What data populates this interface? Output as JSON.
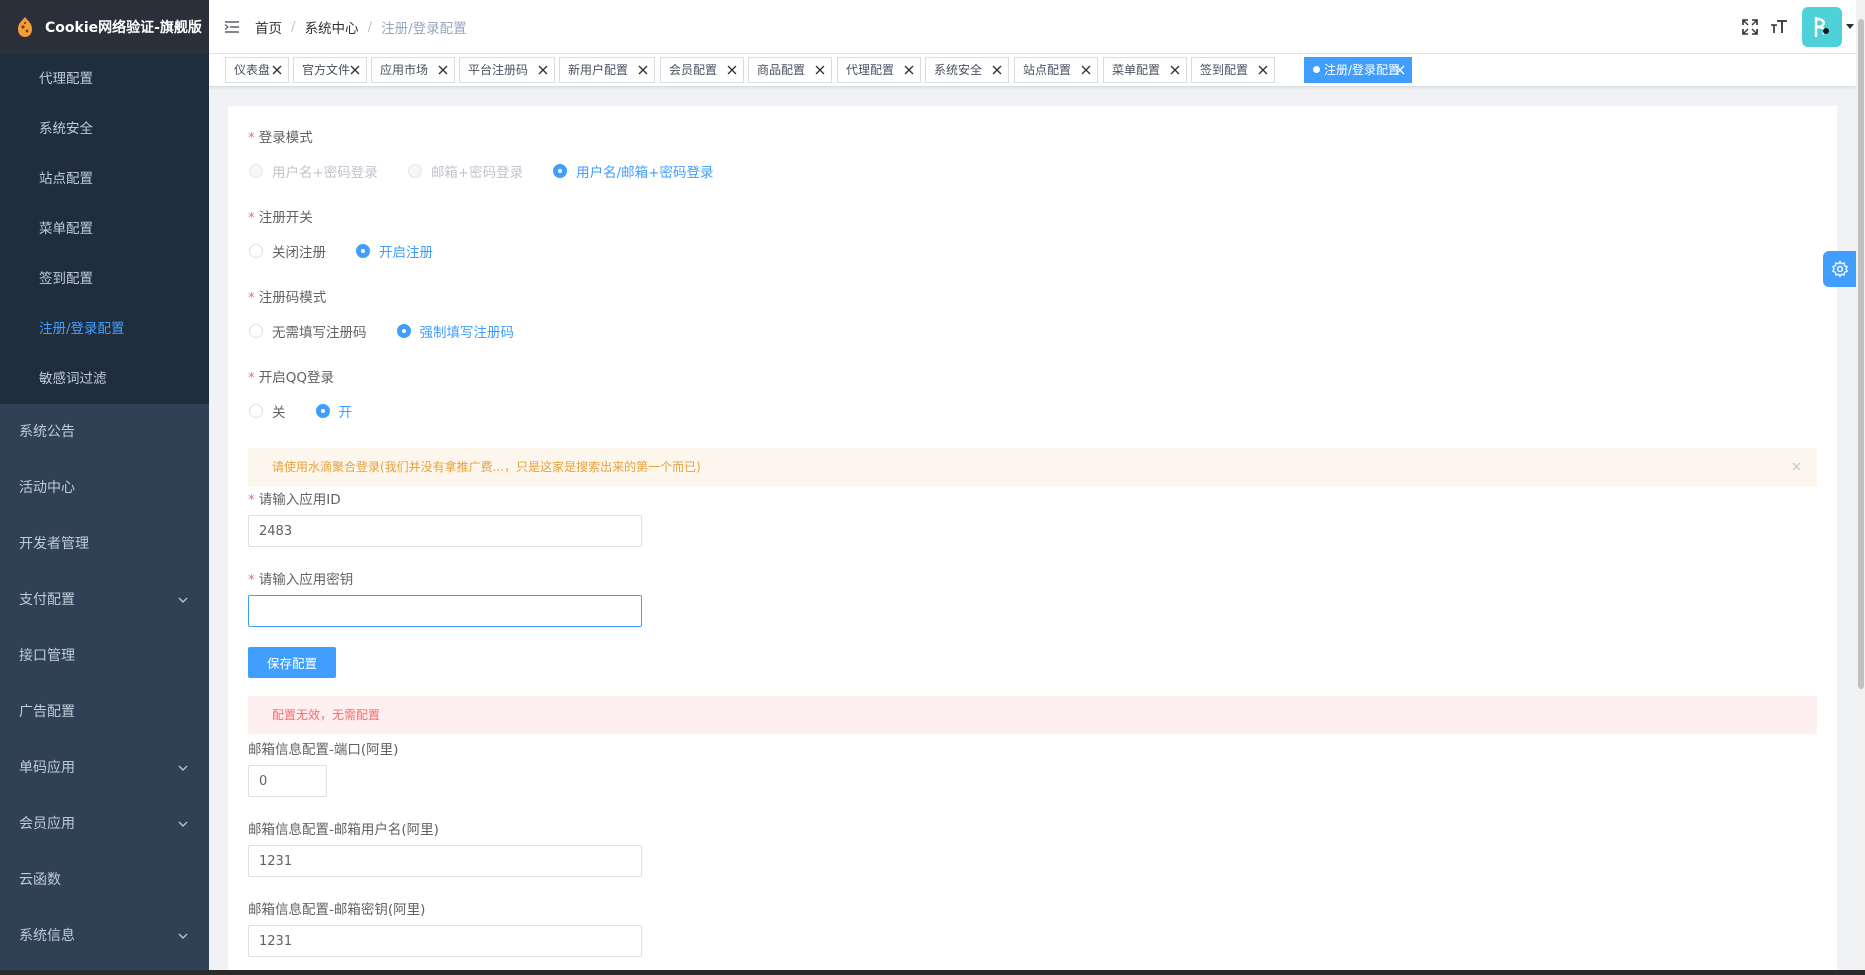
{
  "app": {
    "title": "Cookie网络验证-旗舰版"
  },
  "sidebar": {
    "submenu": [
      {
        "label": "代理配置",
        "active": false
      },
      {
        "label": "系统安全",
        "active": false
      },
      {
        "label": "站点配置",
        "active": false
      },
      {
        "label": "菜单配置",
        "active": false
      },
      {
        "label": "签到配置",
        "active": false
      },
      {
        "label": "注册/登录配置",
        "active": true
      },
      {
        "label": "敏感词过滤",
        "active": false
      }
    ],
    "menu": [
      {
        "label": "系统公告",
        "has_arrow": false
      },
      {
        "label": "活动中心",
        "has_arrow": false
      },
      {
        "label": "开发者管理",
        "has_arrow": false
      },
      {
        "label": "支付配置",
        "has_arrow": true
      },
      {
        "label": "接口管理",
        "has_arrow": false
      },
      {
        "label": "广告配置",
        "has_arrow": false
      },
      {
        "label": "单码应用",
        "has_arrow": true
      },
      {
        "label": "会员应用",
        "has_arrow": true
      },
      {
        "label": "云函数",
        "has_arrow": false
      },
      {
        "label": "系统信息",
        "has_arrow": true
      }
    ]
  },
  "header": {
    "breadcrumb": [
      "首页",
      "系统中心",
      "注册/登录配置"
    ],
    "icons": [
      "fullscreen-icon",
      "font-size-icon"
    ]
  },
  "tags": [
    {
      "label": "仪表盘",
      "active": false
    },
    {
      "label": "官方文件",
      "active": false
    },
    {
      "label": "应用市场",
      "active": false
    },
    {
      "label": "平台注册码",
      "active": false
    },
    {
      "label": "新用户配置",
      "active": false
    },
    {
      "label": "会员配置",
      "active": false
    },
    {
      "label": "商品配置",
      "active": false
    },
    {
      "label": "代理配置",
      "active": false
    },
    {
      "label": "系统安全",
      "active": false
    },
    {
      "label": "站点配置",
      "active": false
    },
    {
      "label": "菜单配置",
      "active": false
    },
    {
      "label": "签到配置",
      "active": false
    },
    {
      "label": "注册/登录配置",
      "active": true
    }
  ],
  "form": {
    "login_mode": {
      "label": "登录模式",
      "options": [
        {
          "label": "用户名+密码登录",
          "state": "disabled"
        },
        {
          "label": "邮箱+密码登录",
          "state": "disabled"
        },
        {
          "label": "用户名/邮箱+密码登录",
          "state": "checked"
        }
      ]
    },
    "register_switch": {
      "label": "注册开关",
      "options": [
        {
          "label": "关闭注册",
          "state": "normal"
        },
        {
          "label": "开启注册",
          "state": "checked"
        }
      ]
    },
    "register_code_mode": {
      "label": "注册码模式",
      "options": [
        {
          "label": "无需填写注册码",
          "state": "normal"
        },
        {
          "label": "强制填写注册码",
          "state": "checked"
        }
      ]
    },
    "qq_login": {
      "label": "开启QQ登录",
      "options": [
        {
          "label": "关",
          "state": "normal"
        },
        {
          "label": "开",
          "state": "checked"
        }
      ]
    },
    "warning_alert": "请使用水滴聚合登录(我们并没有拿推广费...，只是这家是搜索出来的第一个而已)",
    "app_id": {
      "label": "请输入应用ID",
      "value": "2483"
    },
    "app_secret": {
      "label": "请输入应用密钥",
      "value": ""
    },
    "save_label": "保存配置",
    "error_alert": "配置无效，无需配置",
    "mail_port": {
      "label": "邮箱信息配置-端口(阿里)",
      "value": "0"
    },
    "mail_user": {
      "label": "邮箱信息配置-邮箱用户名(阿里)",
      "value": "1231"
    },
    "mail_password": {
      "label": "邮箱信息配置-邮箱密钥(阿里)",
      "value": "1231"
    }
  },
  "colors": {
    "sidebar_bg": "#304156",
    "submenu_bg": "#1f2d3d",
    "primary": "#409eff",
    "warning": "#e6a23c",
    "danger": "#f56c6c"
  }
}
